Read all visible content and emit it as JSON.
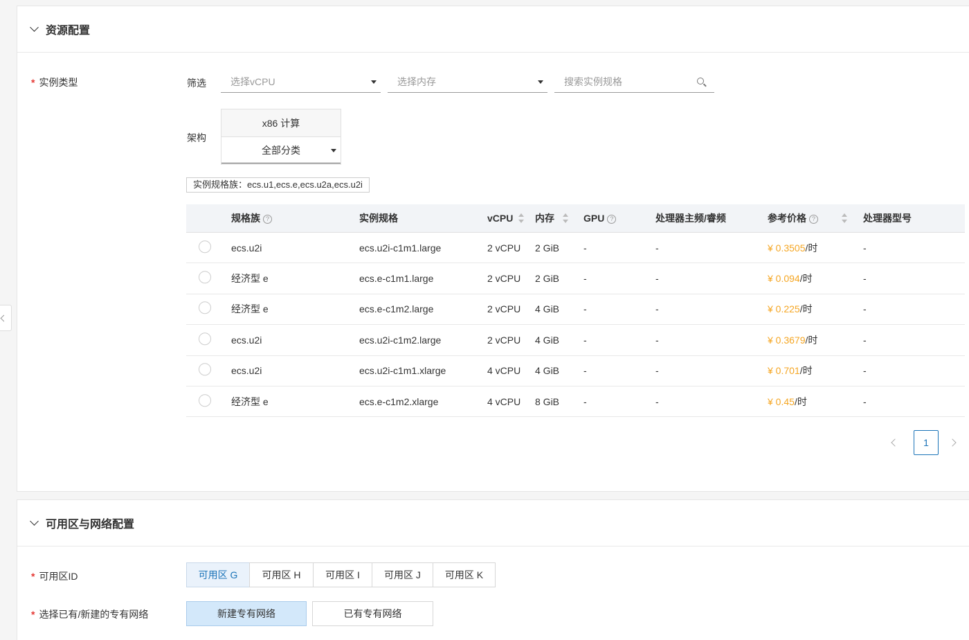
{
  "sections": {
    "resource": {
      "title": "资源配置"
    },
    "network": {
      "title": "可用区与网络配置"
    }
  },
  "instance_type": {
    "label": "实例类型",
    "filter_label": "筛选",
    "vcpu_placeholder": "选择vCPU",
    "memory_placeholder": "选择内存",
    "search_placeholder": "搜索实例规格",
    "arch_label": "架构",
    "arch_value": "x86 计算",
    "category_value": "全部分类",
    "family_tag": "实例规格族：ecs.u1,ecs.e,ecs.u2a,ecs.u2i"
  },
  "table": {
    "columns": [
      "规格族",
      "实例规格",
      "vCPU",
      "内存",
      "GPU",
      "处理器主频/睿频",
      "参考价格",
      "处理器型号"
    ],
    "price_unit": "/时",
    "rows": [
      {
        "family": "ecs.u2i",
        "spec": "ecs.u2i-c1m1.large",
        "vcpu": "2 vCPU",
        "memory": "2 GiB",
        "gpu": "-",
        "freq": "-",
        "price": "¥ 0.3505",
        "model": "-"
      },
      {
        "family": "经济型 e",
        "spec": "ecs.e-c1m1.large",
        "vcpu": "2 vCPU",
        "memory": "2 GiB",
        "gpu": "-",
        "freq": "-",
        "price": "¥ 0.094",
        "model": "-"
      },
      {
        "family": "经济型 e",
        "spec": "ecs.e-c1m2.large",
        "vcpu": "2 vCPU",
        "memory": "4 GiB",
        "gpu": "-",
        "freq": "-",
        "price": "¥ 0.225",
        "model": "-"
      },
      {
        "family": "ecs.u2i",
        "spec": "ecs.u2i-c1m2.large",
        "vcpu": "2 vCPU",
        "memory": "4 GiB",
        "gpu": "-",
        "freq": "-",
        "price": "¥ 0.3679",
        "model": "-"
      },
      {
        "family": "ecs.u2i",
        "spec": "ecs.u2i-c1m1.xlarge",
        "vcpu": "4 vCPU",
        "memory": "4 GiB",
        "gpu": "-",
        "freq": "-",
        "price": "¥ 0.701",
        "model": "-"
      },
      {
        "family": "经济型 e",
        "spec": "ecs.e-c1m2.xlarge",
        "vcpu": "4 vCPU",
        "memory": "8 GiB",
        "gpu": "-",
        "freq": "-",
        "price": "¥ 0.45",
        "model": "-"
      }
    ]
  },
  "pagination": {
    "current": "1"
  },
  "zone": {
    "label": "可用区ID",
    "options": [
      "可用区 G",
      "可用区 H",
      "可用区 I",
      "可用区 J",
      "可用区 K"
    ],
    "selected": "可用区 G"
  },
  "vpc": {
    "label": "选择已有/新建的专有网络",
    "options": [
      "新建专有网络",
      "已有专有网络"
    ],
    "selected": "新建专有网络"
  },
  "colors": {
    "accent": "#1a73b8",
    "price": "#f5a623",
    "required": "#e53935"
  }
}
